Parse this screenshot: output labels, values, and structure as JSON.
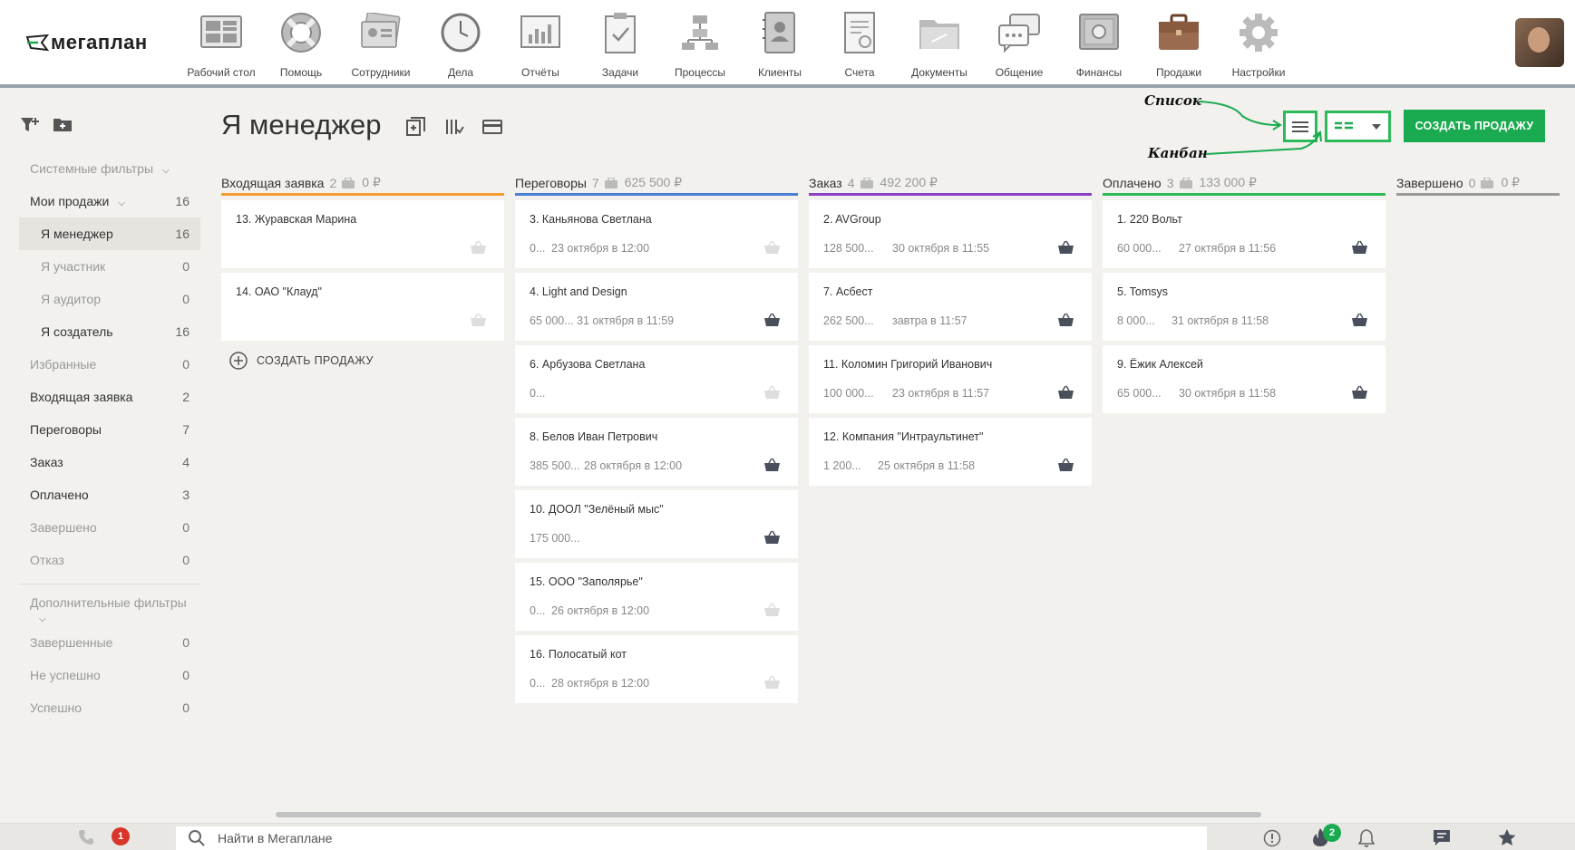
{
  "logo": {
    "text": "мегаплан"
  },
  "nav": [
    {
      "label": "Рабочий стол",
      "icon": "desktop-icon"
    },
    {
      "label": "Помощь",
      "icon": "lifebuoy-icon"
    },
    {
      "label": "Сотрудники",
      "icon": "employees-icon"
    },
    {
      "label": "Дела",
      "icon": "clock-icon"
    },
    {
      "label": "Отчёты",
      "icon": "reports-icon"
    },
    {
      "label": "Задачи",
      "icon": "tasks-icon"
    },
    {
      "label": "Процессы",
      "icon": "processes-icon"
    },
    {
      "label": "Клиенты",
      "icon": "clients-icon"
    },
    {
      "label": "Счета",
      "icon": "invoices-icon"
    },
    {
      "label": "Документы",
      "icon": "documents-icon"
    },
    {
      "label": "Общение",
      "icon": "chat-icon"
    },
    {
      "label": "Финансы",
      "icon": "safe-icon"
    },
    {
      "label": "Продажи",
      "icon": "briefcase-icon"
    },
    {
      "label": "Настройки",
      "icon": "gear-icon"
    }
  ],
  "sidebar": {
    "system_filters": "Системные фильтры",
    "items": [
      {
        "label": "Мои продажи",
        "count": "16"
      },
      {
        "label": "Я менеджер",
        "count": "16"
      },
      {
        "label": "Я участник",
        "count": "0"
      },
      {
        "label": "Я аудитор",
        "count": "0"
      },
      {
        "label": "Я создатель",
        "count": "16"
      },
      {
        "label": "Избранные",
        "count": "0"
      },
      {
        "label": "Входящая заявка",
        "count": "2"
      },
      {
        "label": "Переговоры",
        "count": "7"
      },
      {
        "label": "Заказ",
        "count": "4"
      },
      {
        "label": "Оплачено",
        "count": "3"
      },
      {
        "label": "Завершено",
        "count": "0"
      },
      {
        "label": "Отказ",
        "count": "0"
      }
    ],
    "extra_filters": "Дополнительные фильтры",
    "extra": [
      {
        "label": "Завершенные",
        "count": "0"
      },
      {
        "label": "Не успешно",
        "count": "0"
      },
      {
        "label": "Успешно",
        "count": "0"
      }
    ]
  },
  "page": {
    "title": "Я менеджер",
    "create_button": "СОЗДАТЬ ПРОДАЖУ",
    "annotation_list": "Список",
    "annotation_kanban": "Канбан",
    "add_sale": "СОЗДАТЬ ПРОДАЖУ"
  },
  "colors": {
    "accent": "#1aaa4f",
    "highlight": "#2dbb5a"
  },
  "columns": [
    {
      "name": "Входящая заявка",
      "count": "2",
      "sum": "0 ₽",
      "color": "#f29b30",
      "cards": [
        {
          "title": "13. Журавская Марина",
          "sum": "",
          "date": "",
          "basket_active": false
        },
        {
          "title": "14. ОАО \"Клауд\"",
          "sum": "",
          "date": "",
          "basket_active": false
        }
      ]
    },
    {
      "name": "Переговоры",
      "count": "7",
      "sum": "625 500 ₽",
      "color": "#4a7fd4",
      "cards": [
        {
          "title": "3. Каньянова Светлана",
          "sum": "0...",
          "date": "23 октября в 12:00",
          "basket_active": false
        },
        {
          "title": "4. Light and Design",
          "sum": "65 000...",
          "date": "31 октября в 11:59",
          "basket_active": true
        },
        {
          "title": "6. Арбузова Светлана",
          "sum": "0...",
          "date": "",
          "basket_active": false
        },
        {
          "title": "8. Белов Иван Петрович",
          "sum": "385 500...",
          "date": "28 октября в 12:00",
          "basket_active": true
        },
        {
          "title": "10. ДООЛ \"Зелёный мыс\"",
          "sum": "175 000...",
          "date": "",
          "basket_active": true
        },
        {
          "title": "15. ООО \"Заполярье\"",
          "sum": "0...",
          "date": "26 октября в 12:00",
          "basket_active": false
        },
        {
          "title": "16. Полосатый кот",
          "sum": "0...",
          "date": "28 октября в 12:00",
          "basket_active": false
        }
      ]
    },
    {
      "name": "Заказ",
      "count": "4",
      "sum": "492 200 ₽",
      "color": "#8a3fc7",
      "cards": [
        {
          "title": "2. AVGroup",
          "sum": "128 500...",
          "date": "30 октября в 11:55",
          "basket_active": true
        },
        {
          "title": "7. Асбест",
          "sum": "262 500...",
          "date": "завтра в 11:57",
          "basket_active": true
        },
        {
          "title": "11. Коломин Григорий Иванович",
          "sum": "100 000...",
          "date": "23 октября в 11:57",
          "basket_active": true
        },
        {
          "title": "12. Компания \"Интраультинет\"",
          "sum": "1 200...",
          "date": "25 октября в 11:58",
          "basket_active": true
        }
      ]
    },
    {
      "name": "Оплачено",
      "count": "3",
      "sum": "133 000 ₽",
      "color": "#2dbb5a",
      "cards": [
        {
          "title": "1. 220 Вольт",
          "sum": "60 000...",
          "date": "27 октября в 11:56",
          "basket_active": true
        },
        {
          "title": "5. Tomsys",
          "sum": "8 000...",
          "date": "31 октября в 11:58",
          "basket_active": true
        },
        {
          "title": "9. Ёжик Алексей",
          "sum": "65 000...",
          "date": "30 октября в 11:58",
          "basket_active": true
        }
      ]
    },
    {
      "name": "Завершено",
      "count": "0",
      "sum": "0 ₽",
      "color": "#9a9a9a",
      "cards": []
    }
  ],
  "bottombar": {
    "missed_calls": "1",
    "search_placeholder": "Найти в Мегаплане",
    "hot_count": "2"
  }
}
